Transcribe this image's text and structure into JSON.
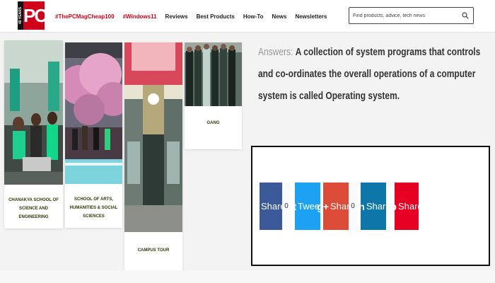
{
  "header": {
    "logo_text": "PC",
    "logo_strip": "40 YEARS",
    "nav": [
      {
        "label": "#ThePCMagCheap100",
        "hot": true
      },
      {
        "label": "#Windows11",
        "hot": true
      },
      {
        "label": "Reviews",
        "hot": false
      },
      {
        "label": "Best Products",
        "hot": false
      },
      {
        "label": "How-To",
        "hot": false
      },
      {
        "label": "News",
        "hot": false
      },
      {
        "label": "Newsletters",
        "hot": false
      }
    ],
    "search_placeholder": "Find products, advice, tech news"
  },
  "cards": [
    {
      "caption": "Chanakya School of Science and Engineering"
    },
    {
      "caption": "School of Arts, Humanities & Social Sciences"
    },
    {
      "caption": "Campus Tour"
    },
    {
      "caption": "Gang"
    }
  ],
  "answer": {
    "label": "Answers:",
    "text": "A collection of system programs that controls and co-ordinates the overall operations of a computer system is called Operating system."
  },
  "share": [
    {
      "label": "Share",
      "icon": "f",
      "icon_name": "facebook-icon",
      "color": "#3b5998",
      "count": "0"
    },
    {
      "label": "Tweet",
      "icon": "t",
      "icon_name": "twitter-icon",
      "color": "#1da1f2",
      "count": null
    },
    {
      "label": "Share",
      "icon": "g+",
      "icon_name": "google-plus-icon",
      "color": "#dd4b39",
      "count": "0"
    },
    {
      "label": "Share",
      "icon": "in",
      "icon_name": "linkedin-icon",
      "color": "#0e76a8",
      "count": null
    },
    {
      "label": "Share",
      "icon": "p",
      "icon_name": "pinterest-icon",
      "color": "#e60023",
      "count": null
    }
  ]
}
